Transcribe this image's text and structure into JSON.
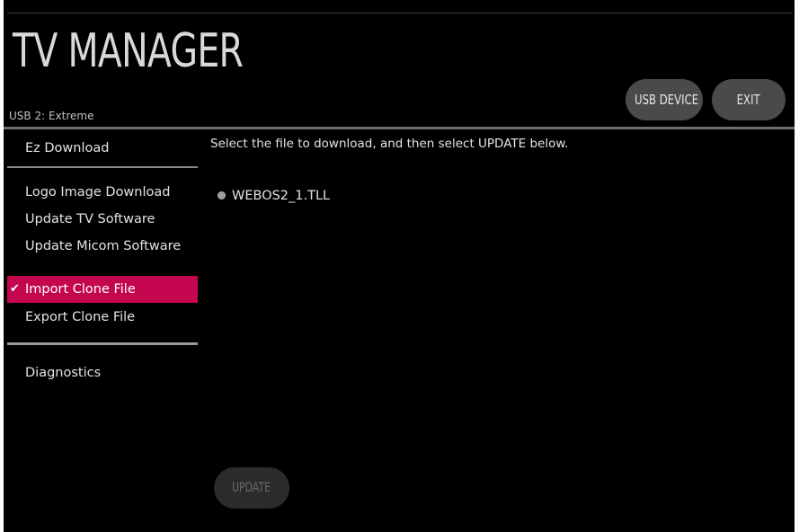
{
  "header": {
    "title": "TV MANAGER",
    "usb_device_name": "USB 2: Extreme",
    "usb_device_button": "USB DEVICE",
    "exit_button": "EXIT"
  },
  "sidebar": {
    "items": [
      {
        "label": "Ez Download",
        "selected": false
      },
      {
        "label": "Logo Image Download",
        "selected": false
      },
      {
        "label": "Update TV Software",
        "selected": false
      },
      {
        "label": "Update Micom Software",
        "selected": false
      },
      {
        "label": "Import Clone File",
        "selected": true,
        "icon": "checkmark-icon"
      },
      {
        "label": "Export Clone File",
        "selected": false
      },
      {
        "label": "Diagnostics",
        "selected": false
      }
    ]
  },
  "main": {
    "instruction": "Select the file to download, and then select UPDATE below.",
    "files": [
      {
        "name": "WEBOS2_1.TLL",
        "icon": "radio-button-icon",
        "selected": false
      }
    ],
    "update_button": "UPDATE",
    "update_enabled": false
  },
  "colors": {
    "background": "#000000",
    "selected_item": "#c4064f",
    "text": "#e3e3e3",
    "button": "#4a4a4a",
    "button_disabled": "#2b2b2b"
  }
}
